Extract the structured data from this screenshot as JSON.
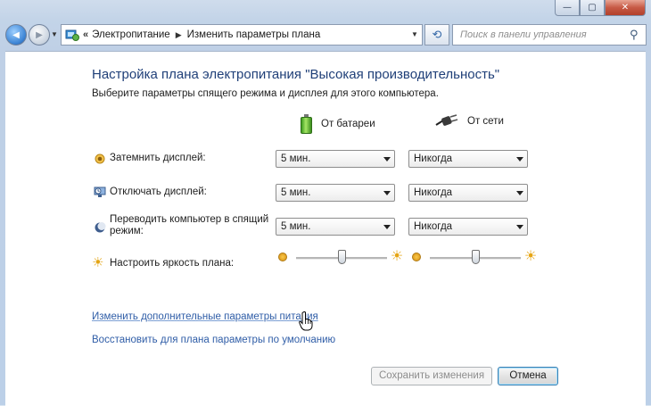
{
  "window": {
    "caption_buttons": [
      "minimize-icon",
      "maximize-icon",
      "close-icon"
    ],
    "close_glyph": "✕",
    "minimize_glyph": "—",
    "maximize_glyph": "▢"
  },
  "address": {
    "back_glyph": "◀",
    "forward_glyph": "▶",
    "overflow": "«",
    "crumbs": [
      "Электропитание",
      "Изменить параметры плана"
    ],
    "crumb_sep": "▶",
    "dropdown_glyph": "▼",
    "refresh_glyph": "⟲",
    "search_placeholder": "Поиск в панели управления",
    "search_glyph": "⚲"
  },
  "page": {
    "title": "Настройка плана электропитания \"Высокая производительность\"",
    "subtitle": "Выберите параметры спящего режима и дисплея для этого компьютера.",
    "columns": {
      "battery": "От батареи",
      "plugged": "От сети"
    },
    "rows": [
      {
        "label": "Затемнить дисплей:",
        "battery_value": "5 мин.",
        "plugged_value": "Никогда",
        "icon": "dim-display-icon"
      },
      {
        "label": "Отключать дисплей:",
        "battery_value": "5 мин.",
        "plugged_value": "Никогда",
        "icon": "monitor-off-icon"
      },
      {
        "label_line1": "Переводить компьютер в спящий",
        "label_line2": "режим:",
        "battery_value": "5 мин.",
        "plugged_value": "Никогда",
        "icon": "sleep-moon-icon"
      }
    ],
    "brightness": {
      "label": "Настроить яркость плана:",
      "battery_level": 0.5,
      "plugged_level": 0.5,
      "icon": "brightness-sun-icon"
    },
    "links": {
      "advanced": "Изменить дополнительные параметры питания",
      "restore": "Восстановить для плана параметры по умолчанию"
    },
    "buttons": {
      "save": "Сохранить изменения",
      "cancel": "Отмена"
    }
  },
  "colors": {
    "title": "#1f3f78",
    "link": "#2f5da7",
    "content_bg": "#ffffff"
  }
}
